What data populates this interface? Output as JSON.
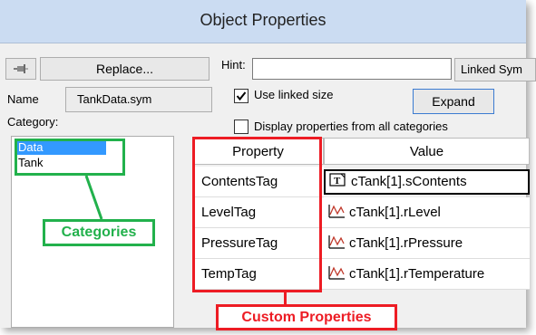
{
  "window": {
    "title": "Object Properties"
  },
  "toolbar": {
    "pin_icon": "pushpin-icon",
    "replace_label": "Replace...",
    "hint_label": "Hint:",
    "hint_value": "",
    "linked_label": "Linked Sym"
  },
  "object": {
    "name_label": "Name",
    "name_value": "TankData.sym",
    "category_label": "Category:"
  },
  "options": {
    "use_linked_size_label": "Use linked size",
    "use_linked_size_checked": true,
    "display_all_label": "Display properties from all categories",
    "display_all_checked": false,
    "expand_label": "Expand"
  },
  "categories": {
    "items": [
      {
        "label": "Data",
        "selected": true
      },
      {
        "label": "Tank",
        "selected": false
      }
    ],
    "callout": "Categories",
    "callout_color": "#22b14c"
  },
  "grid": {
    "header_property": "Property",
    "header_value": "Value",
    "rows": [
      {
        "property": "ContentsTag",
        "value": "cTank[1].sContents",
        "icon": "text-tag-icon"
      },
      {
        "property": "LevelTag",
        "value": "cTank[1].rLevel",
        "icon": "analog-tag-icon"
      },
      {
        "property": "PressureTag",
        "value": "cTank[1].rPressure",
        "icon": "analog-tag-icon"
      },
      {
        "property": "TempTag",
        "value": "cTank[1].rTemperature",
        "icon": "analog-tag-icon"
      }
    ],
    "callout": "Custom Properties",
    "callout_color": "#ed1c24"
  },
  "colors": {
    "titlebar": "#cbdcf2",
    "selection": "#3399ff"
  }
}
